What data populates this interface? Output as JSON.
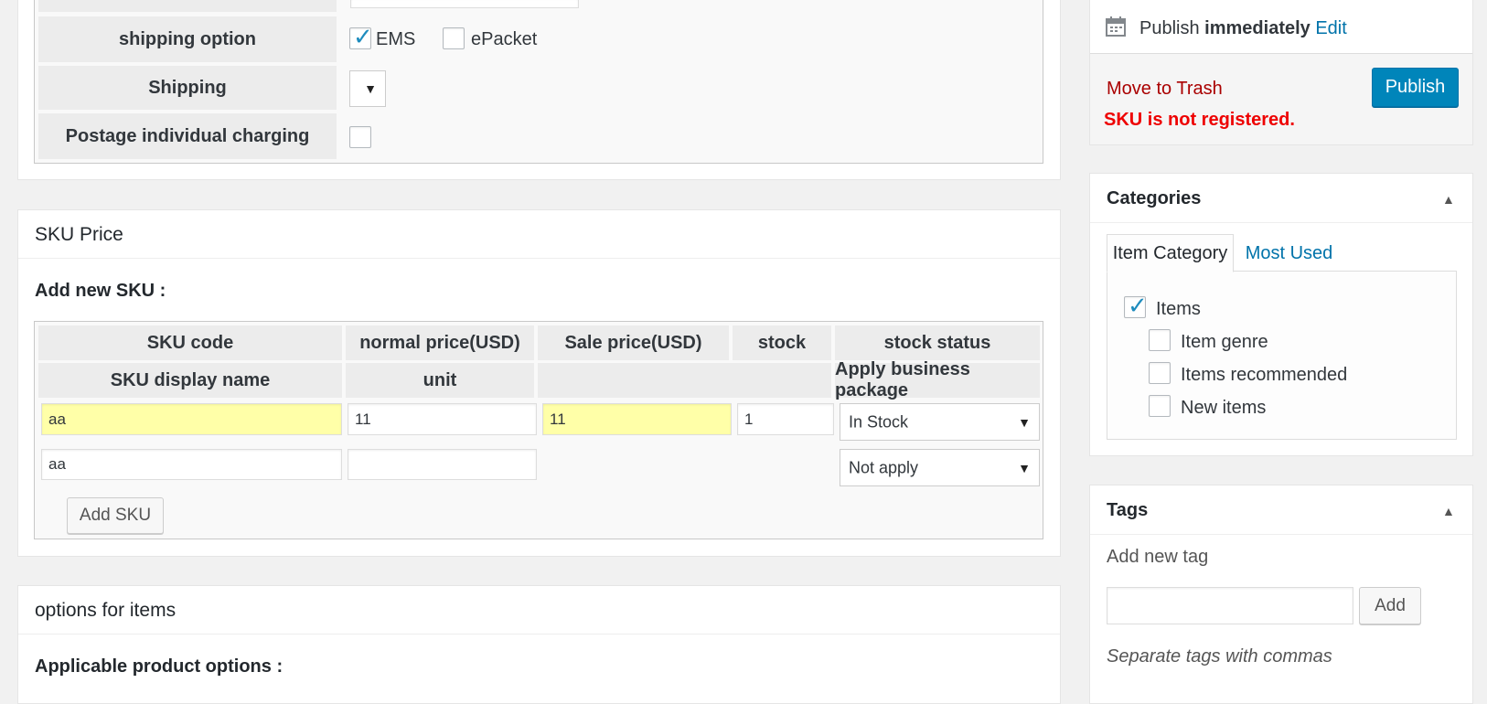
{
  "shipping": {
    "option_label": "shipping option",
    "ems_label": "EMS",
    "ems_checked": true,
    "epacket_label": "ePacket",
    "epacket_checked": false,
    "shipping_label": "Shipping",
    "shipping_select_value": "",
    "postage_label": "Postage individual charging",
    "postage_checked": false
  },
  "sku": {
    "title": "SKU Price",
    "add_new_label": "Add new SKU :",
    "headers_row1": [
      "SKU code",
      "normal price(USD)",
      "Sale price(USD)",
      "stock",
      "stock status"
    ],
    "headers_row2": [
      "SKU display name",
      "unit",
      "",
      "",
      "Apply business package"
    ],
    "row1": {
      "sku_code": "aa",
      "normal_price": "11",
      "sale_price": "11",
      "stock": "1",
      "stock_status": "In Stock"
    },
    "row2": {
      "display_name": "aa",
      "unit": "",
      "business_package": "Not apply"
    },
    "add_button": "Add SKU"
  },
  "options": {
    "title": "options for items",
    "applicable_label": "Applicable product options :"
  },
  "publish": {
    "publish_text": "Publish",
    "publish_when": "immediately",
    "edit_link": "Edit",
    "trash_link": "Move to Trash",
    "publish_button": "Publish",
    "error": "SKU is not registered."
  },
  "categories": {
    "title": "Categories",
    "tab_active": "Item Category",
    "tab_other": "Most Used",
    "items": [
      {
        "label": "Items",
        "checked": true,
        "level": 0
      },
      {
        "label": "Item genre",
        "checked": false,
        "level": 1
      },
      {
        "label": "Items recommended",
        "checked": false,
        "level": 1
      },
      {
        "label": "New items",
        "checked": false,
        "level": 1
      }
    ]
  },
  "tags": {
    "title": "Tags",
    "add_label": "Add new tag",
    "input_value": "",
    "add_button": "Add",
    "hint": "Separate tags with commas"
  },
  "colors": {
    "accent": "#0085ba",
    "link": "#0073aa",
    "error": "#dc3232",
    "trash": "#a00",
    "highlight": "#ffffa8"
  },
  "icons": [
    "calendar-icon",
    "checkmark-icon",
    "chevron-down-icon",
    "collapse-arrow-icon"
  ]
}
